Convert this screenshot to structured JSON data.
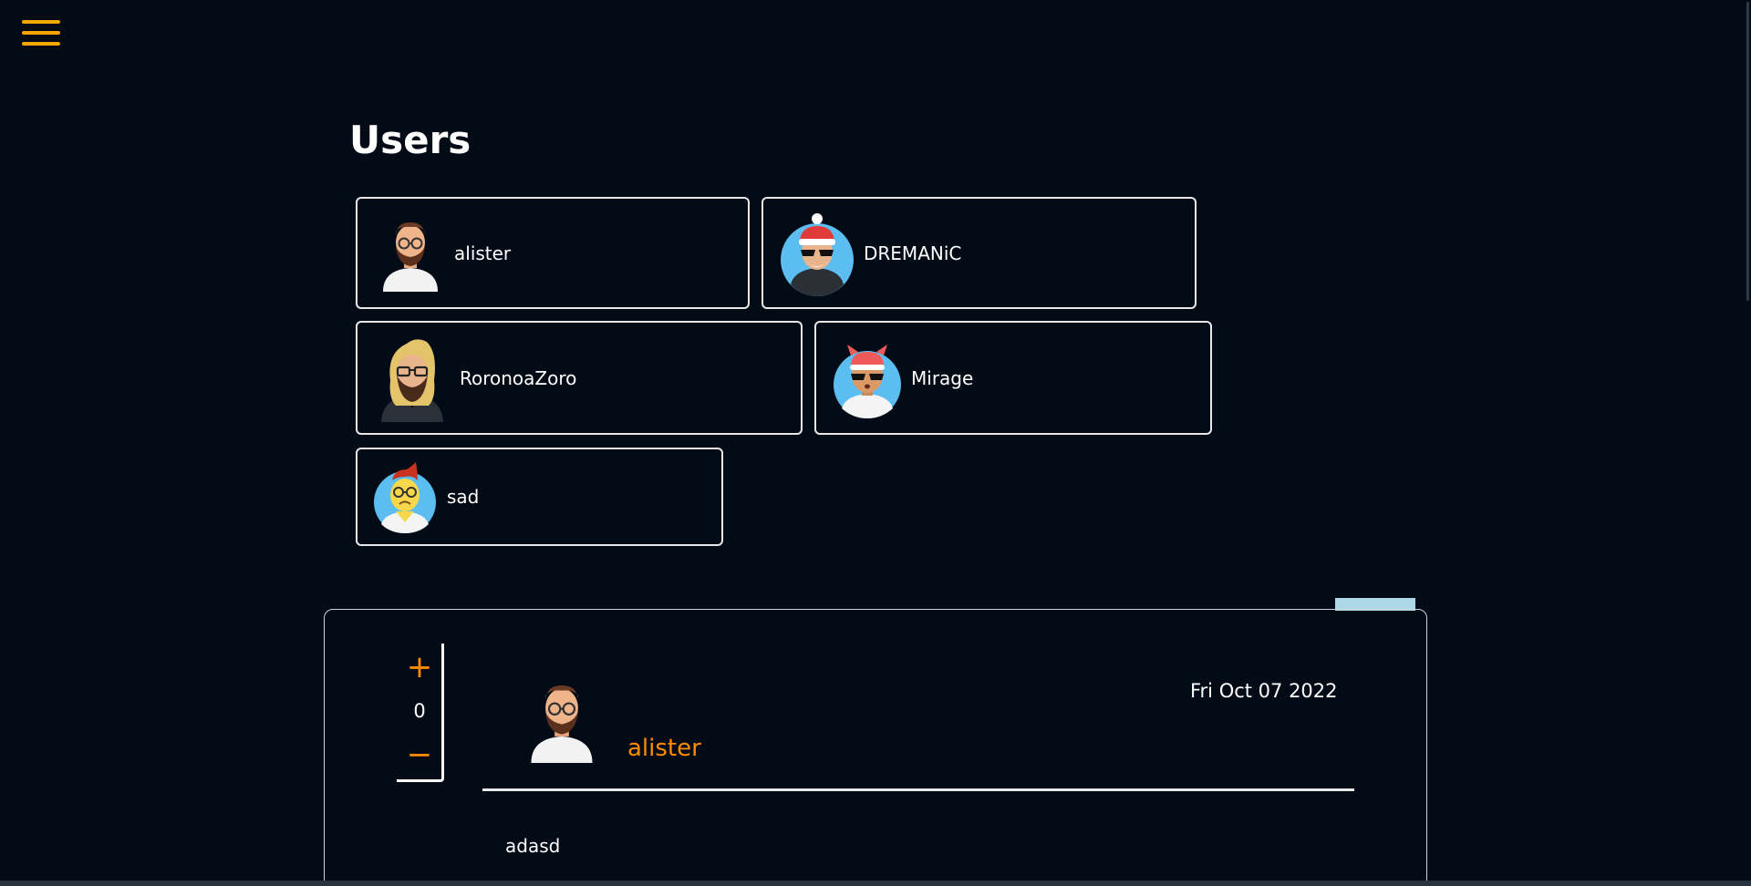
{
  "page": {
    "title": "Users"
  },
  "menu": {
    "icon": "hamburger-menu-icon",
    "color": "#f5a600"
  },
  "users": [
    {
      "name": "alister",
      "avatar": "bearded-man-glasses-avatar"
    },
    {
      "name": "DREMANiC",
      "avatar": "santa-hat-sunglasses-avatar"
    },
    {
      "name": "RoronoaZoro",
      "avatar": "blonde-bearded-man-avatar"
    },
    {
      "name": "Mirage",
      "avatar": "horned-hat-sunglasses-avatar"
    },
    {
      "name": "sad",
      "avatar": "yellow-sad-face-avatar"
    }
  ],
  "post": {
    "votes": {
      "up_label": "+",
      "count": "0",
      "down_label": "−"
    },
    "author": "alister",
    "author_avatar": "bearded-man-glasses-avatar",
    "date": "Fri Oct 07 2022",
    "body": "adasd"
  },
  "colors": {
    "background": "#020b16",
    "accent": "#ff8c00",
    "menu": "#f5a600",
    "tab": "#add8e6"
  }
}
